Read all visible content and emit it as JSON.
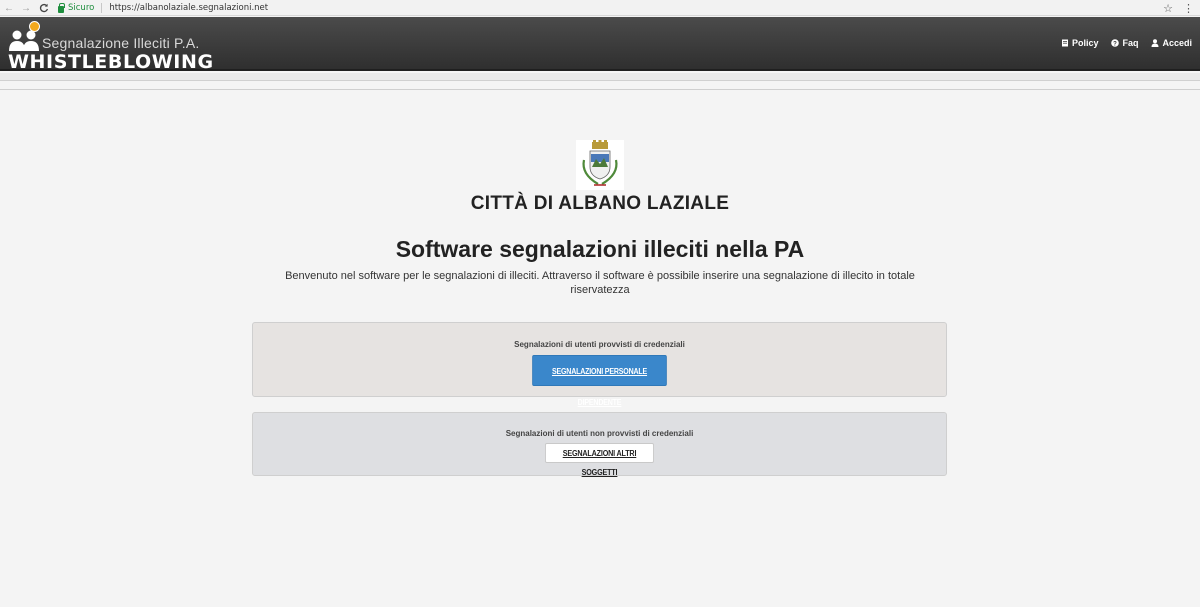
{
  "browser": {
    "back_icon": "arrow-left",
    "forward_icon": "arrow-right",
    "reload_icon": "reload",
    "secure_label": "Sicuro",
    "url": "https://albanolaziale.segnalazioni.net",
    "star_icon": "star",
    "menu_icon": "menu-vertical"
  },
  "header": {
    "logo_sub": "Segnalazione Illeciti P.A.",
    "logo_main": "WHISTLEBLOWING",
    "nav": [
      {
        "label": "Policy",
        "icon": "document-icon"
      },
      {
        "label": "Faq",
        "icon": "help-icon"
      },
      {
        "label": "Accedi",
        "icon": "user-icon"
      }
    ],
    "colors": {
      "bar": "#3a3a3a",
      "logo_accent": "#f2a81d"
    }
  },
  "main": {
    "city": "CITTÀ DI ALBANO LAZIALE",
    "title": "Software segnalazioni illeciti nella PA",
    "intro": "Benvenuto nel software per le segnalazioni di illeciti. Attraverso il software è possibile inserire una segnalazione di illecito in totale riservatezza",
    "panels": [
      {
        "label": "Segnalazioni di utenti provvisti di credenziali",
        "button": "SEGNALAZIONI PERSONALE DIPENDENTE"
      },
      {
        "label": "Segnalazioni di utenti non provvisti di credenziali",
        "button": "SEGNALAZIONI ALTRI SOGGETTI"
      }
    ],
    "colors": {
      "primary_button": "#3a87cb",
      "background": "#f4f4f4"
    }
  }
}
